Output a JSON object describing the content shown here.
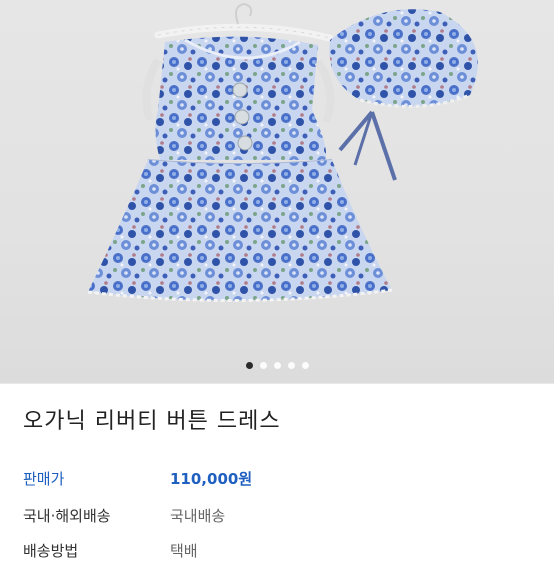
{
  "product": {
    "image_alt_icon": "floral-dress-image",
    "carousel": {
      "total": 5,
      "active": 1
    },
    "title": "오가닉 리버티 버튼 드레스"
  },
  "details": {
    "price_label": "판매가",
    "price_value": "110,000원",
    "shipping_label": "국내·해외배송",
    "shipping_value": "국내배송",
    "method_label": "배송방법",
    "method_value": "택배"
  },
  "colors": {
    "accent": "#1e5fbf",
    "background": "#e4e4e4"
  }
}
